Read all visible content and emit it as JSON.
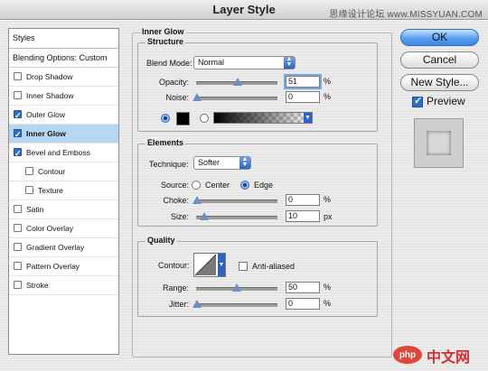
{
  "window": {
    "title": "Layer Style",
    "watermark": "思缘设计论坛 www.MISSYUAN.COM"
  },
  "styles_list": {
    "header": "Styles",
    "blending_options": "Blending Options: Custom",
    "items": [
      {
        "label": "Drop Shadow",
        "checked": false
      },
      {
        "label": "Inner Shadow",
        "checked": false
      },
      {
        "label": "Outer Glow",
        "checked": true
      },
      {
        "label": "Inner Glow",
        "checked": true
      },
      {
        "label": "Bevel and Emboss",
        "checked": true
      },
      {
        "label": "Contour",
        "checked": false
      },
      {
        "label": "Texture",
        "checked": false
      },
      {
        "label": "Satin",
        "checked": false
      },
      {
        "label": "Color Overlay",
        "checked": false
      },
      {
        "label": "Gradient Overlay",
        "checked": false
      },
      {
        "label": "Pattern Overlay",
        "checked": false
      },
      {
        "label": "Stroke",
        "checked": false
      }
    ]
  },
  "inner_glow": {
    "title": "Inner Glow",
    "structure": {
      "title": "Structure",
      "blend_mode_label": "Blend Mode:",
      "blend_mode_value": "Normal",
      "opacity_label": "Opacity:",
      "opacity_value": "51",
      "opacity_unit": "%",
      "noise_label": "Noise:",
      "noise_value": "0",
      "noise_unit": "%"
    },
    "elements": {
      "title": "Elements",
      "technique_label": "Technique:",
      "technique_value": "Softer",
      "source_label": "Source:",
      "source_center": "Center",
      "source_edge": "Edge",
      "choke_label": "Choke:",
      "choke_value": "0",
      "choke_unit": "%",
      "size_label": "Size:",
      "size_value": "10",
      "size_unit": "px"
    },
    "quality": {
      "title": "Quality",
      "contour_label": "Contour:",
      "anti_aliased_label": "Anti-aliased",
      "range_label": "Range:",
      "range_value": "50",
      "range_unit": "%",
      "jitter_label": "Jitter:",
      "jitter_value": "0",
      "jitter_unit": "%"
    }
  },
  "buttons": {
    "ok": "OK",
    "cancel": "Cancel",
    "new_style": "New Style..."
  },
  "preview": {
    "label": "Preview"
  },
  "watermark_bottom": "中文网"
}
